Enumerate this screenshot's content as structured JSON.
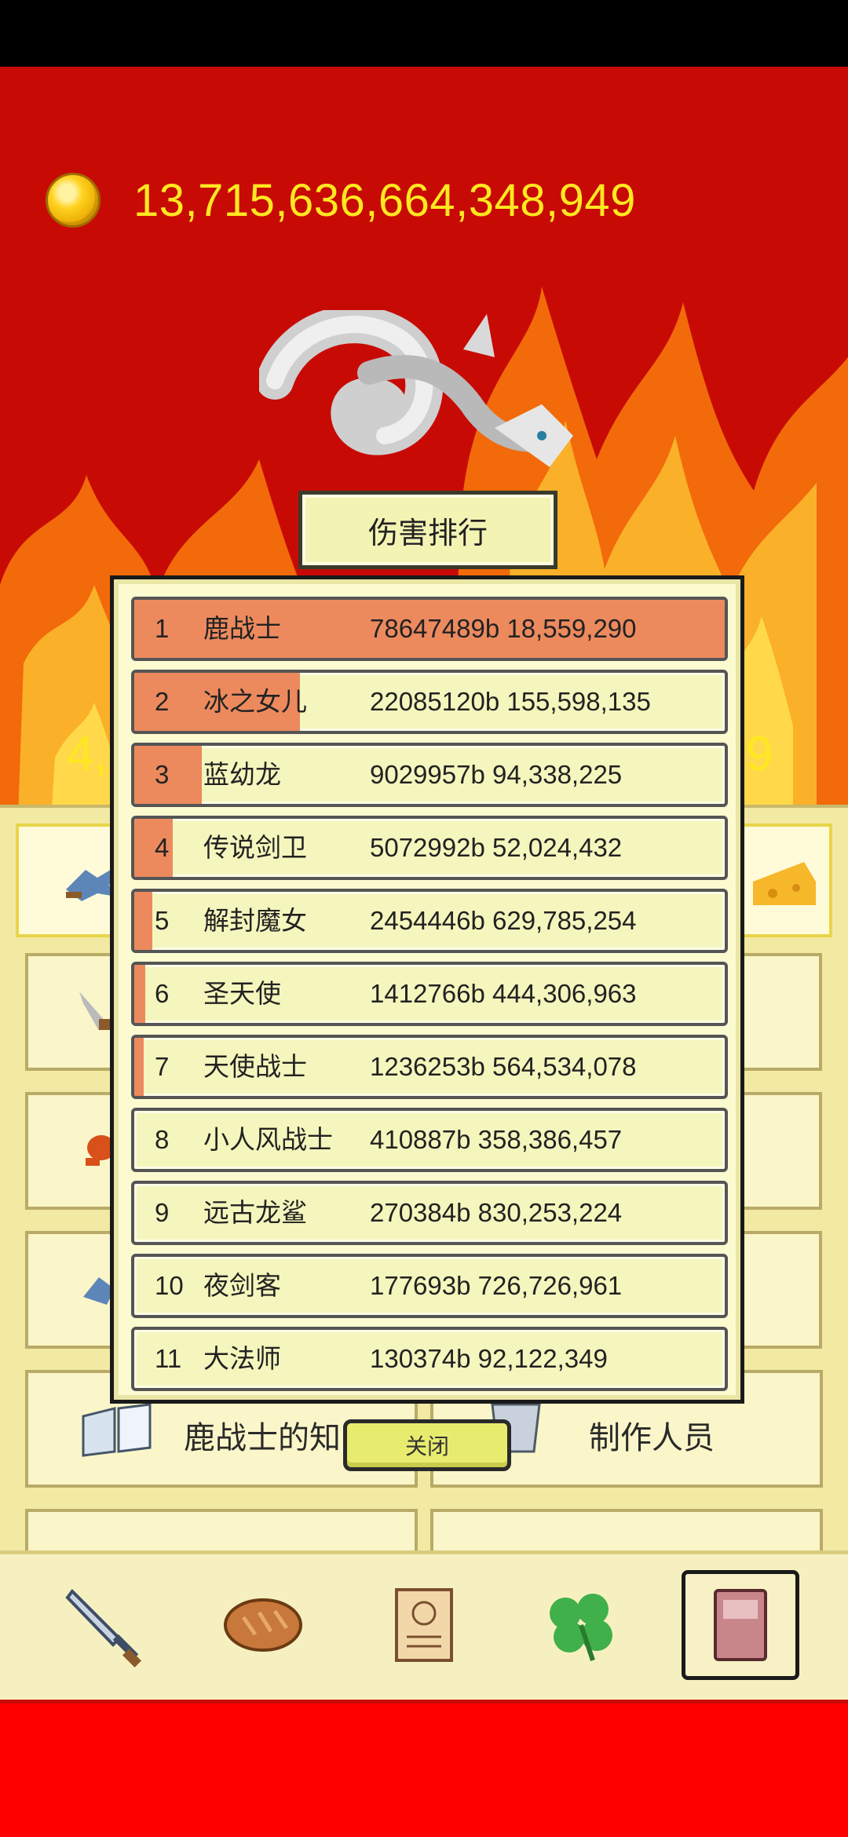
{
  "hud": {
    "gold": "13,715,636,664,348,949",
    "left_value_visible": "4,",
    "right_value_visible": "9"
  },
  "dialog": {
    "title": "伤害排行",
    "close_label": "关闭",
    "rows": [
      {
        "rank": "1",
        "name": "鹿战士",
        "score": "78647489b 18,559,290",
        "bar_fraction": 1.0
      },
      {
        "rank": "2",
        "name": "冰之女儿",
        "score": "22085120b 155,598,135",
        "bar_fraction": 0.28
      },
      {
        "rank": "3",
        "name": "蓝幼龙",
        "score": "9029957b 94,338,225",
        "bar_fraction": 0.115
      },
      {
        "rank": "4",
        "name": "传说剑卫",
        "score": "5072992b 52,024,432",
        "bar_fraction": 0.065
      },
      {
        "rank": "5",
        "name": "解封魔女",
        "score": "2454446b 629,785,254",
        "bar_fraction": 0.031
      },
      {
        "rank": "6",
        "name": "圣天使",
        "score": "1412766b 444,306,963",
        "bar_fraction": 0.018
      },
      {
        "rank": "7",
        "name": "天使战士",
        "score": "1236253b 564,534,078",
        "bar_fraction": 0.016
      },
      {
        "rank": "8",
        "name": "小人风战士",
        "score": "410887b 358,386,457",
        "bar_fraction": 0.0
      },
      {
        "rank": "9",
        "name": "远古龙鲨",
        "score": "270384b 830,253,224",
        "bar_fraction": 0.0
      },
      {
        "rank": "10",
        "name": "夜剑客",
        "score": "177693b 726,726,961",
        "bar_fraction": 0.0
      },
      {
        "rank": "11",
        "name": "大法师",
        "score": "130374b 92,122,349",
        "bar_fraction": 0.0
      }
    ]
  },
  "menu": {
    "tile_left_label": "鹿战士的知",
    "tile_right_label": "制作人员"
  },
  "tabs": [
    {
      "icon": "sword-icon"
    },
    {
      "icon": "bread-icon"
    },
    {
      "icon": "scroll-icon"
    },
    {
      "icon": "clover-icon"
    },
    {
      "icon": "book-icon",
      "selected": true
    }
  ],
  "colors": {
    "sky_red": "#c80a05",
    "gold_text": "#ffe820",
    "bar_fill": "#ec8a5e",
    "row_bg": "#f5f6bd"
  }
}
